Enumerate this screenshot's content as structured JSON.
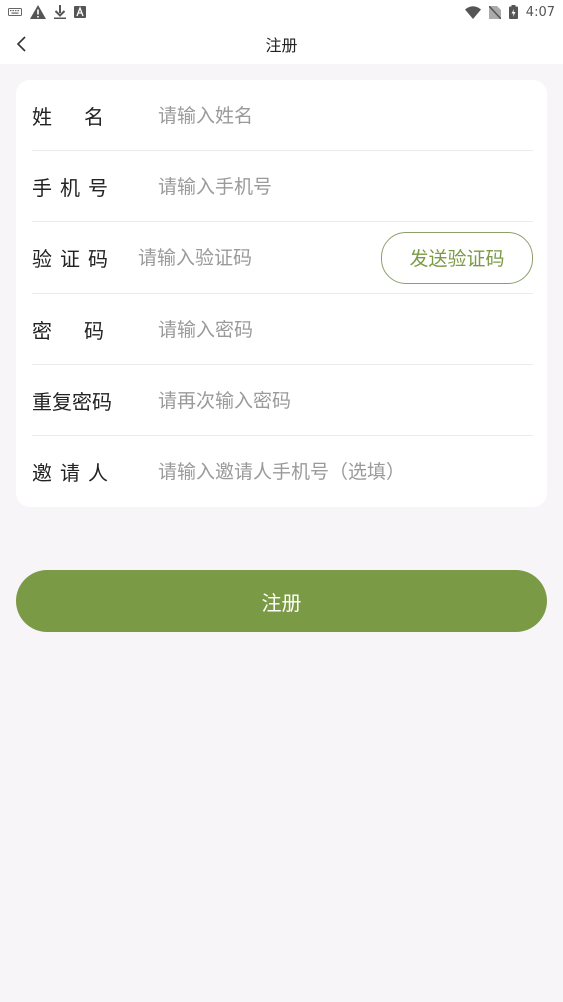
{
  "status_bar": {
    "time": "4:07",
    "icons_left": [
      "keyboard-icon",
      "warning-icon",
      "download-icon",
      "font-icon"
    ],
    "icons_right": [
      "wifi-icon",
      "no-sim-icon",
      "battery-icon"
    ]
  },
  "app_bar": {
    "title": "注册",
    "back_icon": "chevron-left-icon"
  },
  "form": {
    "name": {
      "label": "姓名",
      "placeholder": "请输入姓名"
    },
    "phone": {
      "label": "手机号",
      "placeholder": "请输入手机号"
    },
    "code": {
      "label": "验证码",
      "placeholder": "请输入验证码",
      "send_button": "发送验证码"
    },
    "password": {
      "label": "密码",
      "placeholder": "请输入密码"
    },
    "confirm_password": {
      "label": "重复密码",
      "placeholder": "请再次输入密码"
    },
    "inviter": {
      "label": "邀请人",
      "placeholder": "请输入邀请人手机号（选填）"
    }
  },
  "submit_label": "注册",
  "colors": {
    "accent": "#7b9a46",
    "background": "#f7f5f8",
    "card": "#ffffff"
  }
}
